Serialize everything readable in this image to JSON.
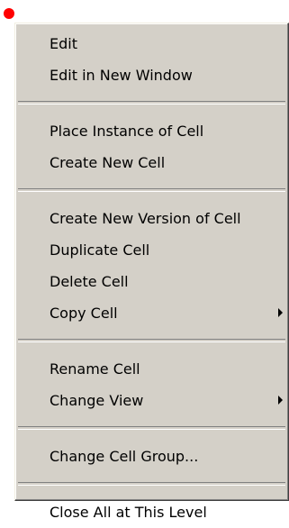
{
  "marker": {
    "color": "#ff0000"
  },
  "menu": {
    "groups": [
      {
        "items": [
          {
            "label": "Edit"
          },
          {
            "label": "Edit in New Window"
          }
        ]
      },
      {
        "items": [
          {
            "label": "Place Instance of Cell"
          },
          {
            "label": "Create New Cell"
          }
        ]
      },
      {
        "items": [
          {
            "label": "Create New Version of Cell"
          },
          {
            "label": "Duplicate Cell"
          },
          {
            "label": "Delete Cell"
          },
          {
            "label": "Copy Cell",
            "submenu": true
          }
        ]
      },
      {
        "items": [
          {
            "label": "Rename Cell"
          },
          {
            "label": "Change View",
            "submenu": true
          }
        ]
      },
      {
        "items": [
          {
            "label": "Change Cell Group..."
          }
        ]
      },
      {
        "items": [
          {
            "label": "Close All at This Level"
          }
        ]
      }
    ]
  }
}
